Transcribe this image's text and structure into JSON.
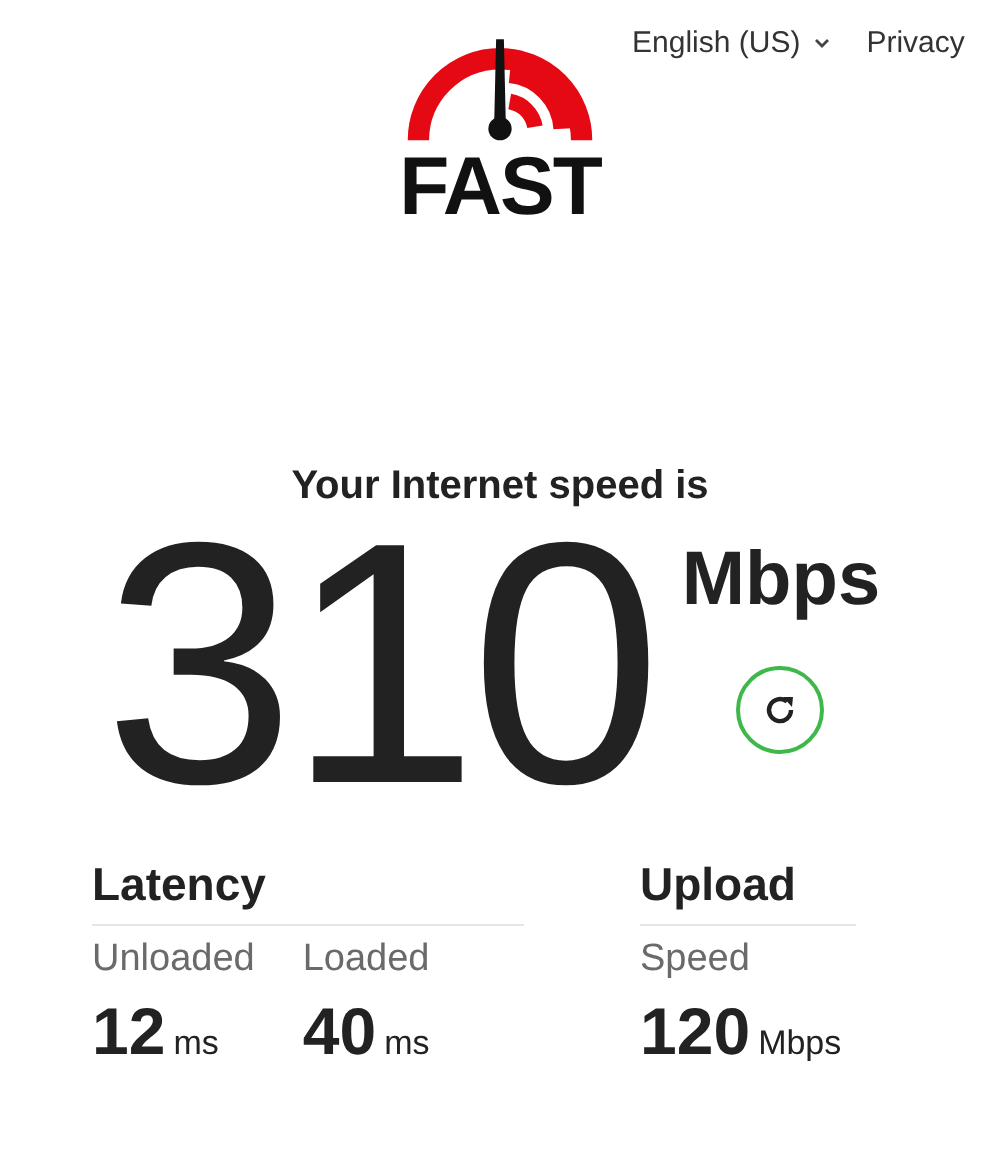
{
  "header": {
    "logo_text": "FAST",
    "language": "English (US)",
    "privacy": "Privacy"
  },
  "speed": {
    "headline": "Your Internet speed is",
    "value": "310",
    "unit": "Mbps"
  },
  "groups": [
    {
      "title": "Latency",
      "metrics": [
        {
          "label": "Unloaded",
          "value": "12",
          "unit": "ms"
        },
        {
          "label": "Loaded",
          "value": "40",
          "unit": "ms"
        }
      ]
    },
    {
      "title": "Upload",
      "metrics": [
        {
          "label": "Speed",
          "value": "120",
          "unit": "Mbps"
        }
      ]
    }
  ]
}
